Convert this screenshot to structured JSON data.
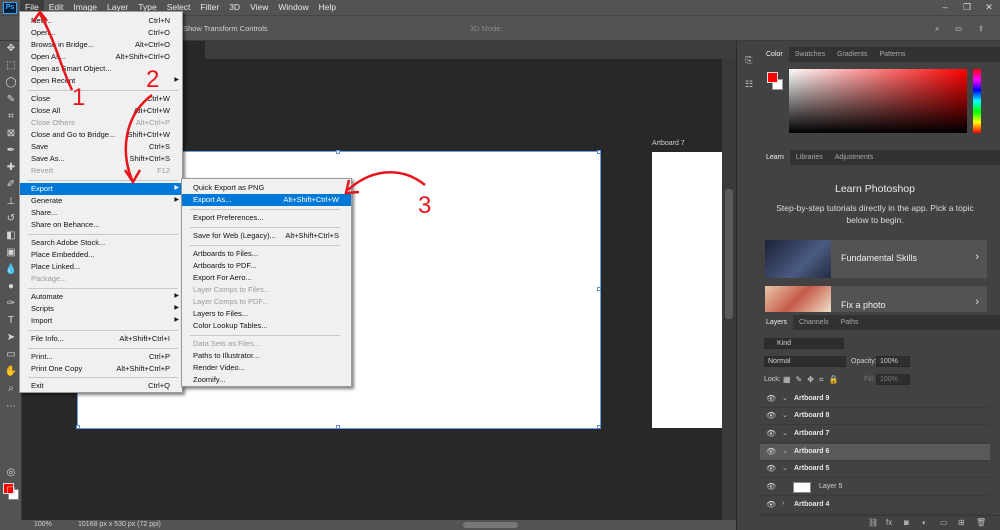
{
  "app": {
    "logo": "Ps"
  },
  "menubar": [
    "File",
    "Edit",
    "Image",
    "Layer",
    "Type",
    "Select",
    "Filter",
    "3D",
    "View",
    "Window",
    "Help"
  ],
  "window_controls": [
    "–",
    "❐",
    "✕"
  ],
  "options_bar": {
    "transform": "Show Transform Controls",
    "mode3d": "3D Mode:"
  },
  "file_menu": [
    {
      "label": "New...",
      "shortcut": "Ctrl+N"
    },
    {
      "label": "Open...",
      "shortcut": "Ctrl+O"
    },
    {
      "label": "Browse in Bridge...",
      "shortcut": "Alt+Ctrl+O"
    },
    {
      "label": "Open As...",
      "shortcut": "Alt+Shift+Ctrl+O"
    },
    {
      "label": "Open as Smart Object...",
      "shortcut": ""
    },
    {
      "label": "Open Recent",
      "shortcut": ""
    },
    {
      "label": "Close",
      "shortcut": "Ctrl+W"
    },
    {
      "label": "Close All",
      "shortcut": "Alt+Ctrl+W"
    },
    {
      "label": "Close Others",
      "shortcut": "Alt+Ctrl+P"
    },
    {
      "label": "Close and Go to Bridge...",
      "shortcut": "Shift+Ctrl+W"
    },
    {
      "label": "Save",
      "shortcut": "Ctrl+S"
    },
    {
      "label": "Save As...",
      "shortcut": "Shift+Ctrl+S"
    },
    {
      "label": "Revert",
      "shortcut": "F12"
    },
    {
      "label": "Export",
      "shortcut": ""
    },
    {
      "label": "Generate",
      "shortcut": ""
    },
    {
      "label": "Share...",
      "shortcut": ""
    },
    {
      "label": "Share on Behance...",
      "shortcut": ""
    },
    {
      "label": "Search Adobe Stock...",
      "shortcut": ""
    },
    {
      "label": "Place Embedded...",
      "shortcut": ""
    },
    {
      "label": "Place Linked...",
      "shortcut": ""
    },
    {
      "label": "Package...",
      "shortcut": ""
    },
    {
      "label": "Automate",
      "shortcut": ""
    },
    {
      "label": "Scripts",
      "shortcut": ""
    },
    {
      "label": "Import",
      "shortcut": ""
    },
    {
      "label": "File Info...",
      "shortcut": "Alt+Shift+Ctrl+I"
    },
    {
      "label": "Print...",
      "shortcut": "Ctrl+P"
    },
    {
      "label": "Print One Copy",
      "shortcut": "Alt+Shift+Ctrl+P"
    },
    {
      "label": "Exit",
      "shortcut": "Ctrl+Q"
    }
  ],
  "export_menu": [
    {
      "label": "Quick Export as PNG",
      "shortcut": ""
    },
    {
      "label": "Export As...",
      "shortcut": "Alt+Shift+Ctrl+W"
    },
    {
      "label": "Export Preferences...",
      "shortcut": ""
    },
    {
      "label": "Save for Web (Legacy)...",
      "shortcut": "Alt+Shift+Ctrl+S"
    },
    {
      "label": "Artboards to Files...",
      "shortcut": ""
    },
    {
      "label": "Artboards to PDF...",
      "shortcut": ""
    },
    {
      "label": "Export For Aero...",
      "shortcut": ""
    },
    {
      "label": "Layer Comps to Files...",
      "shortcut": ""
    },
    {
      "label": "Layer Comps to PDF...",
      "shortcut": ""
    },
    {
      "label": "Layers to Files...",
      "shortcut": ""
    },
    {
      "label": "Color Lookup Tables...",
      "shortcut": ""
    },
    {
      "label": "Data Sets as Files...",
      "shortcut": ""
    },
    {
      "label": "Paths to Illustrator...",
      "shortcut": ""
    },
    {
      "label": "Render Video...",
      "shortcut": ""
    },
    {
      "label": "Zoomify...",
      "shortcut": ""
    }
  ],
  "canvas": {
    "artboard7_label": "Artboard 7"
  },
  "status": {
    "zoom": "100%",
    "doc": "10168 px x 530 px (72 ppi)"
  },
  "color_panel": {
    "tabs": [
      "Color",
      "Swatches",
      "Gradients",
      "Patterns"
    ],
    "fg": "#ff0000",
    "bg": "#ffffff"
  },
  "learn_panel": {
    "tabs": [
      "Learn",
      "Libraries",
      "Adjustments"
    ],
    "title": "Learn Photoshop",
    "desc": "Step-by-step tutorials directly in the app. Pick a topic below to begin.",
    "cards": [
      "Fundamental Skills",
      "Fix a photo"
    ]
  },
  "layers_panel": {
    "tabs": [
      "Layers",
      "Channels",
      "Paths"
    ],
    "filter": "Kind",
    "blend": "Normal",
    "opacity_label": "Opacity:",
    "opacity": "100%",
    "lock_label": "Lock:",
    "fill_label": "Fill:",
    "fill": "100%",
    "layers": [
      "Artboard 9",
      "Artboard 8",
      "Artboard 7",
      "Artboard 6",
      "Artboard 5",
      "Layer 5",
      "Artboard 4"
    ]
  },
  "annotations": [
    "1",
    "2",
    "3"
  ],
  "accent": "#e8141c"
}
